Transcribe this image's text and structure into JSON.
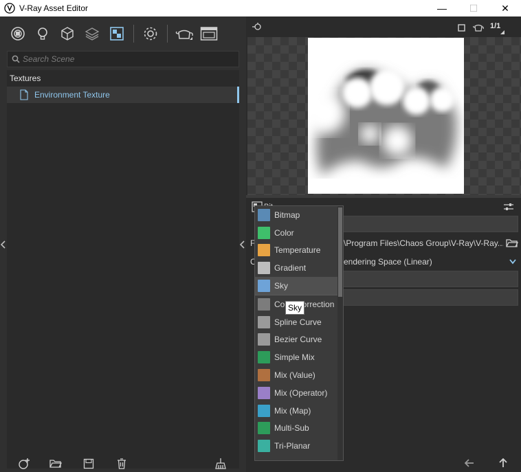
{
  "window": {
    "title": "V-Ray Asset Editor",
    "minimize": "—",
    "maximize": "☐",
    "close": "✕"
  },
  "search": {
    "placeholder": "Search Scene"
  },
  "tree": {
    "category": "Textures",
    "items": [
      {
        "label": "Environment Texture"
      }
    ]
  },
  "preview_toolbar": {
    "ratio": "1/1"
  },
  "properties": {
    "header": "Bit",
    "rows": [
      {
        "label": "F",
        "value": "\\Program Files\\Chaos Group\\V-Ray\\V-Ray..."
      },
      {
        "label": "C",
        "value": "endering Space (Linear)"
      }
    ]
  },
  "menu": {
    "items": [
      {
        "label": "Bitmap",
        "color": "#5a8ab5"
      },
      {
        "label": "Color",
        "color": "#3fbf6b"
      },
      {
        "label": "Temperature",
        "color": "#e7a343"
      },
      {
        "label": "Gradient",
        "color": "#bdbdbd"
      },
      {
        "label": "Sky",
        "color": "#6ea3d8"
      },
      {
        "label": "Color Correction",
        "color": "#7c7c7c"
      },
      {
        "label": "Spline Curve",
        "color": "#9a9a9a"
      },
      {
        "label": "Bezier Curve",
        "color": "#9a9a9a"
      },
      {
        "label": "Simple Mix",
        "color": "#2d9c5a"
      },
      {
        "label": "Mix (Value)",
        "color": "#b07040"
      },
      {
        "label": "Mix (Operator)",
        "color": "#9a7fc8"
      },
      {
        "label": "Mix (Map)",
        "color": "#3aa0c8"
      },
      {
        "label": "Multi-Sub",
        "color": "#2d9c5a"
      },
      {
        "label": "Tri-Planar",
        "color": "#3ab0a0"
      }
    ],
    "highlighted": "Sky"
  },
  "tooltip": {
    "text": "Sky"
  },
  "colors": {
    "accent": "#8fc6ec",
    "panel": "#303030",
    "background": "#2b2b2b"
  }
}
